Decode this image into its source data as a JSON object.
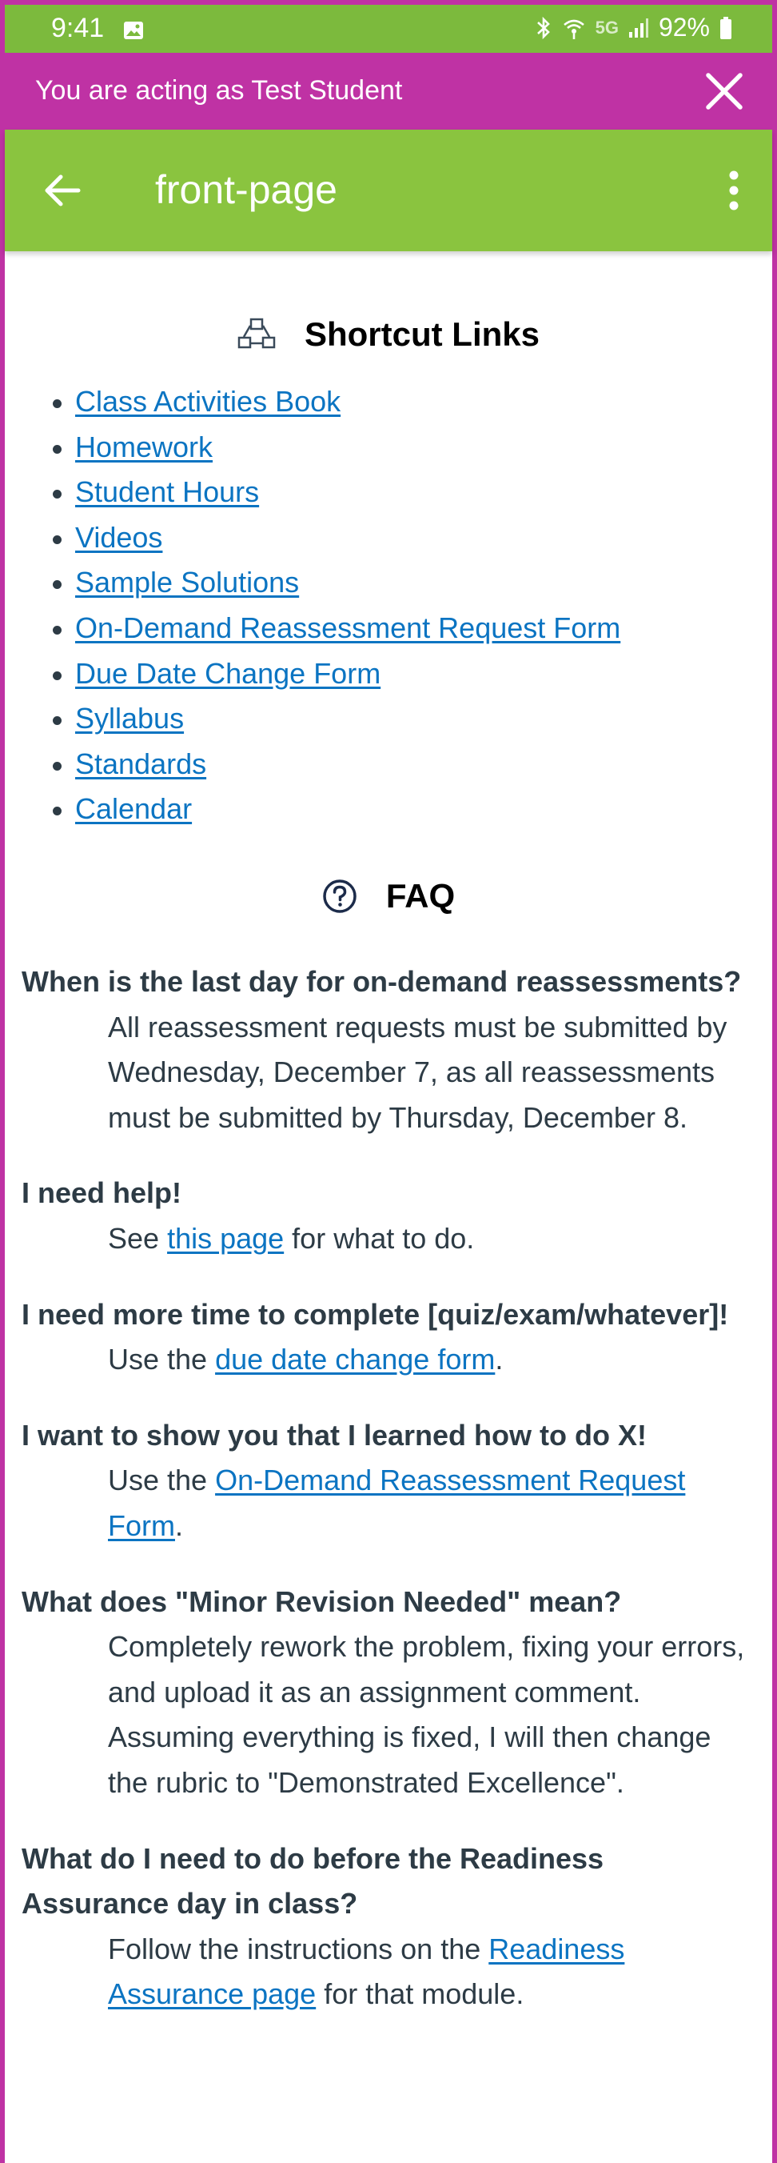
{
  "status_bar": {
    "time": "9:41",
    "network": "5G",
    "battery": "92%",
    "icons": [
      "photo-icon",
      "bluetooth-icon",
      "wifi-calling-icon",
      "signal-icon",
      "battery-icon"
    ]
  },
  "student_banner": {
    "text": "You are acting as Test Student",
    "close_icon": "close-icon",
    "background": "#bf32a4"
  },
  "app_bar": {
    "title": "front-page",
    "back_icon": "arrow-left-icon",
    "menu_icon": "more-vertical-icon",
    "background": "#8ac43f"
  },
  "shortcuts": {
    "heading": "Shortcut Links",
    "icon": "shortcut-network-icon",
    "links": [
      "Class Activities Book",
      "Homework",
      "Student Hours",
      "Videos",
      "Sample Solutions",
      "On-Demand Reassessment Request Form",
      "Due Date Change Form",
      "Syllabus",
      "Standards",
      "Calendar"
    ]
  },
  "faq": {
    "heading": "FAQ",
    "icon": "question-circle-icon",
    "items": [
      {
        "question": "When is the last day for on-demand reassessments?",
        "answer": "All reassessment requests must be submitted by Wednesday, December 7, as all reassessments must be submitted by Thursday, December 8."
      },
      {
        "question": "I need help!",
        "answer_before": "See ",
        "answer_link": "this page",
        "answer_after": " for what to do."
      },
      {
        "question": "I need more time to complete [quiz/exam/whatever]!",
        "answer_before": "Use the ",
        "answer_link": "due date change form",
        "answer_after": "."
      },
      {
        "question": "I want to show you that I learned how to do X!",
        "answer_before": "Use the ",
        "answer_link": "On-Demand Reassessment Request Form",
        "answer_after": "."
      },
      {
        "question": "What does \"Minor Revision Needed\" mean?",
        "answer": "Completely rework the problem, fixing your errors, and upload it as an assignment comment. Assuming everything is fixed, I will then change the rubric to \"Demonstrated Excellence\"."
      },
      {
        "question": "What do I need to do before the Readiness Assurance day in class?",
        "answer_before": "Follow the instructions on the ",
        "answer_link": "Readiness Assurance page",
        "answer_after": " for that module."
      }
    ]
  },
  "colors": {
    "link": "#0b74c2",
    "text": "#2d3b45",
    "status_bar": "#7cba3d"
  }
}
